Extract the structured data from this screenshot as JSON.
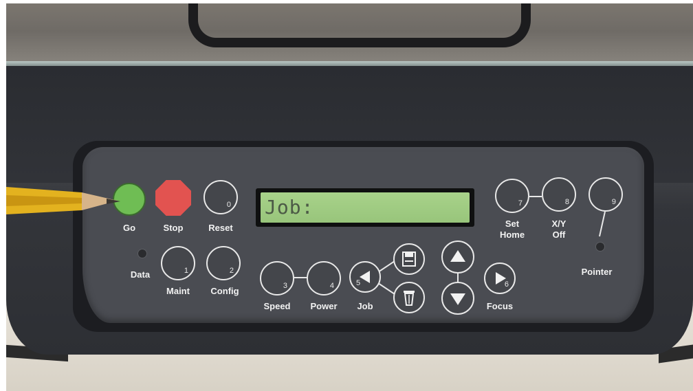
{
  "lcd": {
    "text": "Job:"
  },
  "buttons": {
    "go": "Go",
    "stop": "Stop",
    "reset": {
      "label": "Reset",
      "number": "0"
    },
    "maint": {
      "label": "Maint",
      "number": "1"
    },
    "config": {
      "label": "Config",
      "number": "2"
    },
    "speed": {
      "label": "Speed",
      "number": "3"
    },
    "power": {
      "label": "Power",
      "number": "4"
    },
    "job": {
      "label": "Job",
      "number": "5"
    },
    "focus": {
      "label": "Focus",
      "number": "6"
    },
    "set_home": {
      "label_line1": "Set",
      "label_line2": "Home",
      "number": "7"
    },
    "xy_off": {
      "label_line1": "X/Y",
      "label_line2": "Off",
      "number": "8"
    },
    "pointer": {
      "label": "Pointer",
      "number": "9"
    }
  },
  "indicators": {
    "data": "Data"
  },
  "icons": [
    "save-icon",
    "trash-icon",
    "arrow-left-icon",
    "arrow-up-icon",
    "arrow-down-icon",
    "arrow-right-icon"
  ],
  "colors": {
    "go": "#6fbd54",
    "stop": "#e25350",
    "lcd": "#a8d28a",
    "panel": "#4a4c52"
  }
}
